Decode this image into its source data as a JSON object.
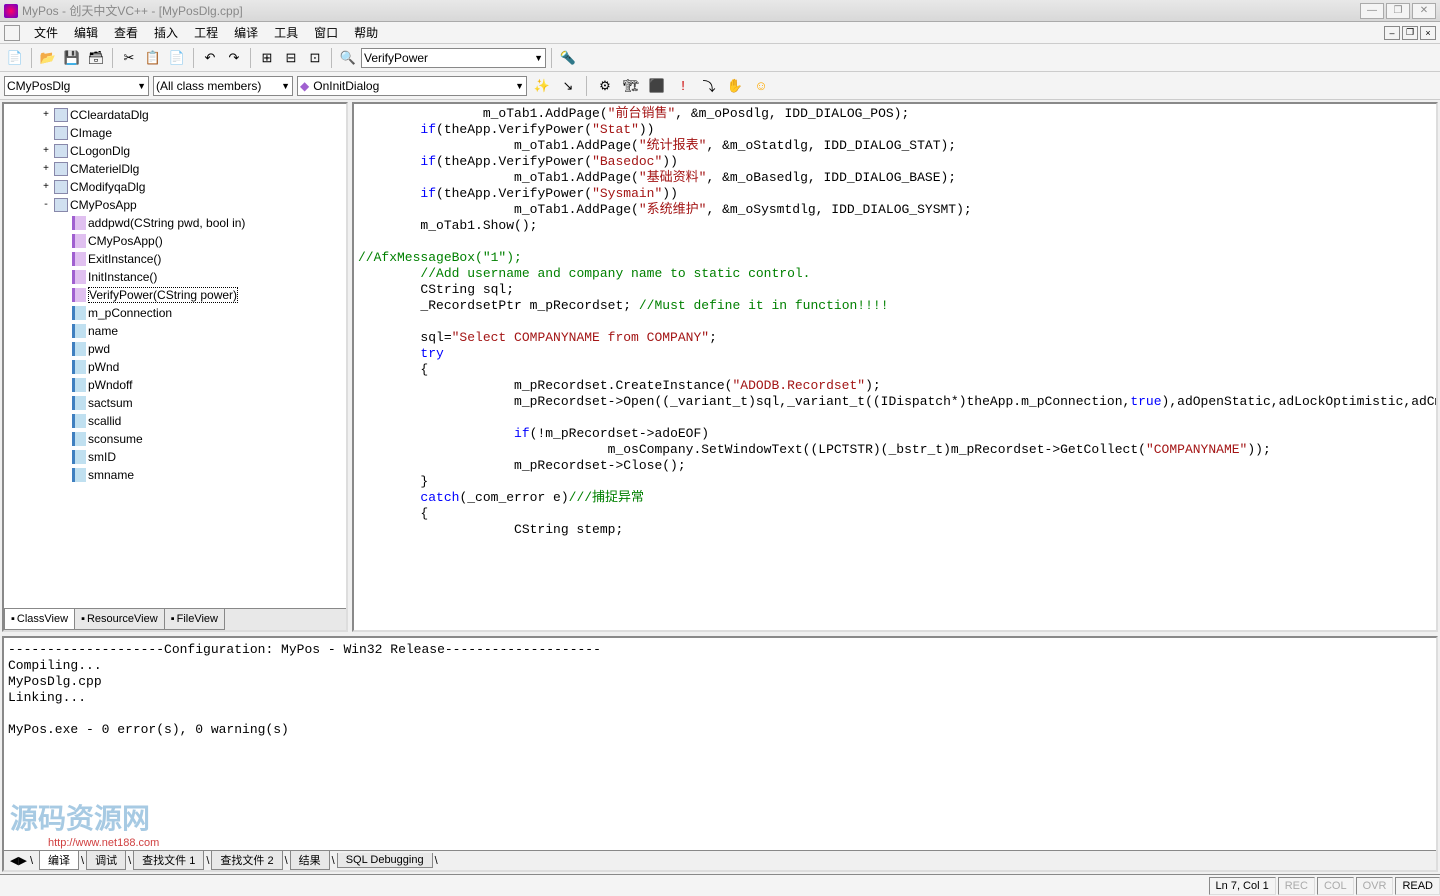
{
  "window": {
    "title": "MyPos - 创天中文VC++ - [MyPosDlg.cpp]"
  },
  "menu": {
    "items": [
      "文件",
      "编辑",
      "查看",
      "插入",
      "工程",
      "编译",
      "工具",
      "窗口",
      "帮助"
    ]
  },
  "toolbar1": {
    "combo_find": "VerifyPower"
  },
  "toolbar2": {
    "class_combo": "CMyPosDlg",
    "filter_combo": "(All class members)",
    "member_combo": "OnInitDialog"
  },
  "tree": {
    "nodes": [
      {
        "depth": 1,
        "exp": "+",
        "ico": "class",
        "label": "CCleardataDlg"
      },
      {
        "depth": 1,
        "exp": "",
        "ico": "class",
        "label": "CImage"
      },
      {
        "depth": 1,
        "exp": "+",
        "ico": "class",
        "label": "CLogonDlg"
      },
      {
        "depth": 1,
        "exp": "+",
        "ico": "class",
        "label": "CMaterielDlg"
      },
      {
        "depth": 1,
        "exp": "+",
        "ico": "class",
        "label": "CModifyqaDlg"
      },
      {
        "depth": 1,
        "exp": "-",
        "ico": "class",
        "label": "CMyPosApp"
      },
      {
        "depth": 2,
        "exp": "",
        "ico": "method",
        "label": "addpwd(CString pwd, bool in)"
      },
      {
        "depth": 2,
        "exp": "",
        "ico": "method",
        "label": "CMyPosApp()"
      },
      {
        "depth": 2,
        "exp": "",
        "ico": "method",
        "label": "ExitInstance()"
      },
      {
        "depth": 2,
        "exp": "",
        "ico": "method",
        "label": "InitInstance()"
      },
      {
        "depth": 2,
        "exp": "",
        "ico": "method",
        "label": "VerifyPower(CString power)",
        "selected": true
      },
      {
        "depth": 2,
        "exp": "",
        "ico": "field",
        "label": "m_pConnection"
      },
      {
        "depth": 2,
        "exp": "",
        "ico": "field",
        "label": "name"
      },
      {
        "depth": 2,
        "exp": "",
        "ico": "field",
        "label": "pwd"
      },
      {
        "depth": 2,
        "exp": "",
        "ico": "field",
        "label": "pWnd"
      },
      {
        "depth": 2,
        "exp": "",
        "ico": "field",
        "label": "pWndoff"
      },
      {
        "depth": 2,
        "exp": "",
        "ico": "field",
        "label": "sactsum"
      },
      {
        "depth": 2,
        "exp": "",
        "ico": "field",
        "label": "scallid"
      },
      {
        "depth": 2,
        "exp": "",
        "ico": "field",
        "label": "sconsume"
      },
      {
        "depth": 2,
        "exp": "",
        "ico": "field",
        "label": "smID"
      },
      {
        "depth": 2,
        "exp": "",
        "ico": "field",
        "label": "smname"
      }
    ]
  },
  "sidebar_tabs": {
    "items": [
      "ClassView",
      "ResourceView",
      "FileView"
    ],
    "active": 0
  },
  "code_lines": [
    {
      "indent": 16,
      "tokens": [
        {
          "t": "m_oTab1.AddPage("
        },
        {
          "t": "\"前台销售\"",
          "c": "str"
        },
        {
          "t": ", &m_oPosdlg, IDD_DIALOG_POS);"
        }
      ]
    },
    {
      "indent": 8,
      "tokens": [
        {
          "t": "if",
          "c": "kw"
        },
        {
          "t": "(theApp.VerifyPower("
        },
        {
          "t": "\"Stat\"",
          "c": "str"
        },
        {
          "t": "))"
        }
      ]
    },
    {
      "indent": 20,
      "tokens": [
        {
          "t": "m_oTab1.AddPage("
        },
        {
          "t": "\"统计报表\"",
          "c": "str"
        },
        {
          "t": ", &m_oStatdlg, IDD_DIALOG_STAT);"
        }
      ]
    },
    {
      "indent": 8,
      "tokens": [
        {
          "t": "if",
          "c": "kw"
        },
        {
          "t": "(theApp.VerifyPower("
        },
        {
          "t": "\"Basedoc\"",
          "c": "str"
        },
        {
          "t": "))"
        }
      ]
    },
    {
      "indent": 20,
      "tokens": [
        {
          "t": "m_oTab1.AddPage("
        },
        {
          "t": "\"基础资料\"",
          "c": "str"
        },
        {
          "t": ", &m_oBasedlg, IDD_DIALOG_BASE);"
        }
      ]
    },
    {
      "indent": 8,
      "tokens": [
        {
          "t": "if",
          "c": "kw"
        },
        {
          "t": "(theApp.VerifyPower("
        },
        {
          "t": "\"Sysmain\"",
          "c": "str"
        },
        {
          "t": "))"
        }
      ]
    },
    {
      "indent": 20,
      "tokens": [
        {
          "t": "m_oTab1.AddPage("
        },
        {
          "t": "\"系统维护\"",
          "c": "str"
        },
        {
          "t": ", &m_oSysmtdlg, IDD_DIALOG_SYSMT);"
        }
      ]
    },
    {
      "indent": 8,
      "tokens": [
        {
          "t": "m_oTab1.Show();"
        }
      ]
    },
    {
      "indent": 0,
      "tokens": []
    },
    {
      "indent": 0,
      "tokens": [
        {
          "t": "//AfxMessageBox(\"1\");",
          "c": "cmt"
        }
      ]
    },
    {
      "indent": 8,
      "tokens": [
        {
          "t": "//Add username and company name to static control.",
          "c": "cmt"
        }
      ]
    },
    {
      "indent": 8,
      "tokens": [
        {
          "t": "CString sql;"
        }
      ]
    },
    {
      "indent": 8,
      "tokens": [
        {
          "t": "_RecordsetPtr m_pRecordset; "
        },
        {
          "t": "//Must define it in function!!!!",
          "c": "cmt"
        }
      ]
    },
    {
      "indent": 0,
      "tokens": []
    },
    {
      "indent": 8,
      "tokens": [
        {
          "t": "sql="
        },
        {
          "t": "\"Select COMPANYNAME from COMPANY\"",
          "c": "str"
        },
        {
          "t": ";"
        }
      ]
    },
    {
      "indent": 8,
      "tokens": [
        {
          "t": "try",
          "c": "kw"
        }
      ]
    },
    {
      "indent": 8,
      "tokens": [
        {
          "t": "{"
        }
      ]
    },
    {
      "indent": 20,
      "tokens": [
        {
          "t": "m_pRecordset.CreateInstance("
        },
        {
          "t": "\"ADODB.Recordset\"",
          "c": "str"
        },
        {
          "t": ");"
        }
      ]
    },
    {
      "indent": 20,
      "tokens": [
        {
          "t": "m_pRecordset->Open((_variant_t)sql,_variant_t((IDispatch*)theApp.m_pConnection,"
        },
        {
          "t": "true",
          "c": "kw"
        },
        {
          "t": "),adOpenStatic,adLockOptimistic,adCmdTe"
        }
      ]
    },
    {
      "indent": 0,
      "tokens": []
    },
    {
      "indent": 20,
      "tokens": [
        {
          "t": "if",
          "c": "kw"
        },
        {
          "t": "(!m_pRecordset->adoEOF)"
        }
      ]
    },
    {
      "indent": 32,
      "tokens": [
        {
          "t": "m_osCompany.SetWindowText((LPCTSTR)(_bstr_t)m_pRecordset->GetCollect("
        },
        {
          "t": "\"COMPANYNAME\"",
          "c": "str"
        },
        {
          "t": "));"
        }
      ]
    },
    {
      "indent": 20,
      "tokens": [
        {
          "t": "m_pRecordset->Close();"
        }
      ]
    },
    {
      "indent": 8,
      "tokens": [
        {
          "t": "}"
        }
      ]
    },
    {
      "indent": 8,
      "tokens": [
        {
          "t": "catch",
          "c": "kw"
        },
        {
          "t": "(_com_error e)"
        },
        {
          "t": "///捕捉异常",
          "c": "cmt"
        }
      ]
    },
    {
      "indent": 8,
      "tokens": [
        {
          "t": "{"
        }
      ]
    },
    {
      "indent": 20,
      "tokens": [
        {
          "t": "CString stemp;"
        }
      ]
    }
  ],
  "output": {
    "text": "--------------------Configuration: MyPos - Win32 Release--------------------\nCompiling...\nMyPosDlg.cpp\nLinking...\n\nMyPos.exe - 0 error(s), 0 warning(s)",
    "tabs": [
      "编译",
      "调试",
      "查找文件 1",
      "查找文件 2",
      "结果",
      "SQL Debugging"
    ],
    "active": 0
  },
  "status": {
    "pos": "Ln 7, Col 1",
    "ind": [
      "REC",
      "COL",
      "OVR",
      "READ"
    ]
  },
  "watermark": "源码资源网",
  "watermark_url": "http://www.net188.com"
}
